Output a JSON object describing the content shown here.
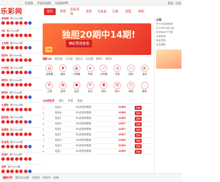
{
  "brand": {
    "logo_text": "乐彩网"
  },
  "topbar": {
    "links": [
      "开奖网",
      "手机乐彩网",
      "乐彩网APP"
    ],
    "right": [
      "登录",
      "注册"
    ]
  },
  "nav": [
    "首页",
    "开奖",
    "乐彩论坛",
    "买彩",
    "七乐彩",
    "工具",
    "社区",
    "体彩"
  ],
  "left_lotteries": [
    {
      "tag": "双色球",
      "info": "第25xxx期"
    },
    {
      "tag": "3D",
      "info": "第25xxx期"
    },
    {
      "tag": "七乐彩",
      "info": "第25xxx期"
    },
    {
      "tag": "快乐8",
      "info": "第25xxx期"
    },
    {
      "tag": "大乐透",
      "info": "第25xxx期"
    },
    {
      "tag": "排列3",
      "info": "第25xxx期"
    },
    {
      "tag": "排列5",
      "info": "第25xxx期"
    },
    {
      "tag": "七星彩",
      "info": "第25xxx期"
    },
    {
      "tag": "胜负彩",
      "info": "第25xxx期"
    },
    {
      "tag": "进球彩",
      "info": "第25xxx期"
    },
    {
      "tag": "半全场",
      "info": "第25xxx期"
    },
    {
      "tag": "任选9",
      "info": "第25xxx期"
    },
    {
      "tag": "竞彩",
      "info": "第25xxx期"
    }
  ],
  "banner": {
    "title": "独胆20期中14期!",
    "sub": "精彩预测查看",
    "badge": "13期"
  },
  "tabs": [
    "福彩3D",
    "双色球",
    "七乐彩",
    "快乐8",
    "大乐透",
    "排列3",
    "排列5"
  ],
  "icons": [
    {
      "icon": "chart-icon",
      "label": "走势图"
    },
    {
      "icon": "filter-icon",
      "label": "缩水"
    },
    {
      "icon": "calc-icon",
      "label": "计算器"
    },
    {
      "icon": "star-icon",
      "label": "专家"
    },
    {
      "icon": "trend-icon",
      "label": "分布图"
    },
    {
      "icon": "bell-icon",
      "label": "开奖"
    },
    {
      "icon": "book-icon",
      "label": "资料"
    },
    {
      "icon": "gift-icon",
      "label": "活动"
    },
    {
      "icon": "tool-icon",
      "label": "工具"
    },
    {
      "icon": "grid-icon",
      "label": "选号"
    },
    {
      "icon": "user-icon",
      "label": "会员"
    },
    {
      "icon": "chat-icon",
      "label": "论坛"
    },
    {
      "icon": "news-icon",
      "label": "资讯"
    },
    {
      "icon": "data-icon",
      "label": "统计"
    },
    {
      "icon": "shop-icon",
      "label": "商城"
    },
    {
      "icon": "more-icon",
      "label": "更多"
    }
  ],
  "table": {
    "headers": [
      "3D试机号",
      "排行",
      "中奖",
      "状态"
    ],
    "rows": [
      {
        "rank": "1",
        "name": "彩友A",
        "desc": "3D试机号预测",
        "hit": "10中8",
        "action": "查看"
      },
      {
        "rank": "2",
        "name": "彩友B",
        "desc": "3D试机号预测",
        "hit": "10中8",
        "action": "查看"
      },
      {
        "rank": "3",
        "name": "彩友C",
        "desc": "3D试机号预测",
        "hit": "10中8",
        "action": "查看"
      },
      {
        "rank": "4",
        "name": "彩友D",
        "desc": "3D试机号预测",
        "hit": "10中7",
        "action": "查看"
      },
      {
        "rank": "5",
        "name": "彩友E",
        "desc": "3D试机号预测",
        "hit": "10中7",
        "action": "查看"
      },
      {
        "rank": "6",
        "name": "彩友F",
        "desc": "3D试机号预测",
        "hit": "10中7",
        "action": "查看"
      },
      {
        "rank": "7",
        "name": "彩友G",
        "desc": "3D试机号预测",
        "hit": "10中6",
        "action": "查看"
      },
      {
        "rank": "8",
        "name": "彩友H",
        "desc": "3D试机号预测",
        "hit": "10中6",
        "action": "查看"
      },
      {
        "rank": "9",
        "name": "彩友I",
        "desc": "3D试机号预测",
        "hit": "10中6",
        "action": "查看"
      }
    ]
  },
  "right": {
    "announce": "公告",
    "lines": [
      "关于乐彩网停更",
      "2025年乐彩公告",
      "乐彩网APP下载",
      "中奖故事",
      "彩民须知",
      "站务通知"
    ]
  },
  "footer": {
    "lead": "福彩3D",
    "text": "第25xxx期 · 试机号 · 开机号 · 金码"
  },
  "colors": {
    "accent": "#e02a2a",
    "blue_ball": "#2a62d6"
  }
}
